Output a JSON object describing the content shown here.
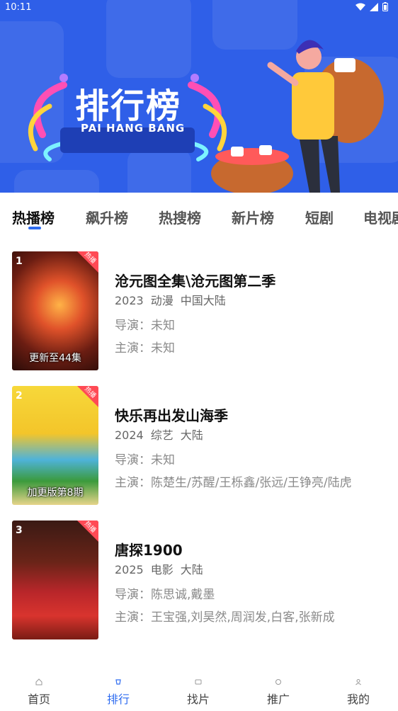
{
  "status": {
    "time": "10:11"
  },
  "banner": {
    "title": "排行榜",
    "subtitle": "PAI HANG BANG"
  },
  "tabs": [
    "热播榜",
    "飙升榜",
    "热搜榜",
    "新片榜",
    "短剧",
    "电视剧"
  ],
  "active_tab": 0,
  "items": [
    {
      "rank": "1",
      "badge": "热播",
      "episode": "更新至44集",
      "title": "沧元图全集\\沧元图第二季",
      "year": "2023",
      "genre": "动漫",
      "region": "中国大陆",
      "director": "导演：未知",
      "actors": "主演：未知"
    },
    {
      "rank": "2",
      "badge": "热播",
      "episode": "加更版第8期",
      "title": "快乐再出发山海季",
      "year": "2024",
      "genre": "综艺",
      "region": "大陆",
      "director": "导演：未知",
      "actors": "主演：陈楚生/苏醒/王栎鑫/张远/王铮亮/陆虎"
    },
    {
      "rank": "3",
      "badge": "热播",
      "episode": "",
      "title": "唐探1900",
      "year": "2025",
      "genre": "电影",
      "region": "大陆",
      "director": "导演：陈思诚,戴墨",
      "actors": "主演：王宝强,刘昊然,周润发,白客,张新成"
    }
  ],
  "nav": [
    {
      "label": "首页",
      "icon": "home-icon"
    },
    {
      "label": "排行",
      "icon": "rank-icon"
    },
    {
      "label": "找片",
      "icon": "find-icon"
    },
    {
      "label": "推广",
      "icon": "promote-icon"
    },
    {
      "label": "我的",
      "icon": "profile-icon"
    }
  ],
  "active_nav": 1,
  "colors": {
    "banner": "#2f5fe8",
    "accent": "#2f6cf0",
    "badge": "#ff4a55"
  }
}
